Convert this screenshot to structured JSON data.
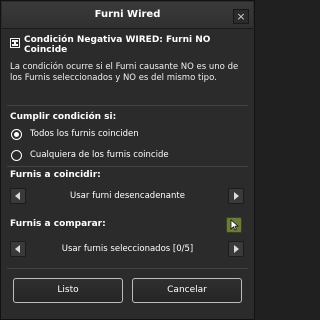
{
  "window": {
    "title": "Furni Wired",
    "close_glyph": "×"
  },
  "header": {
    "title": "Condición Negativa WIRED: Furni NO Coincide",
    "description": "La condición ocurre si el Furni causante NO es uno de los Furnis seleccionados y NO es del mismo tipo."
  },
  "condition": {
    "label": "Cumplir condición si:",
    "options": [
      {
        "label": "Todos los furnis coinciden",
        "selected": true
      },
      {
        "label": "Cualquiera de los furnis coincide",
        "selected": false
      }
    ]
  },
  "furni_match": {
    "label": "Furnis a coincidir:",
    "value": "Usar furni desencadenante"
  },
  "furni_compare": {
    "label": "Furnis a comparar:",
    "value": "Usar furnis seleccionados [0/5]"
  },
  "actions": {
    "ok_label": "Listo",
    "cancel_label": "Cancelar"
  },
  "colors": {
    "background": "#2b2b2b",
    "pick_button": "#6d7b3a"
  },
  "icons": [
    "close-icon",
    "wired-condition-icon",
    "radio-icon",
    "arrow-left-icon",
    "arrow-right-icon",
    "pick-furni-icon"
  ]
}
